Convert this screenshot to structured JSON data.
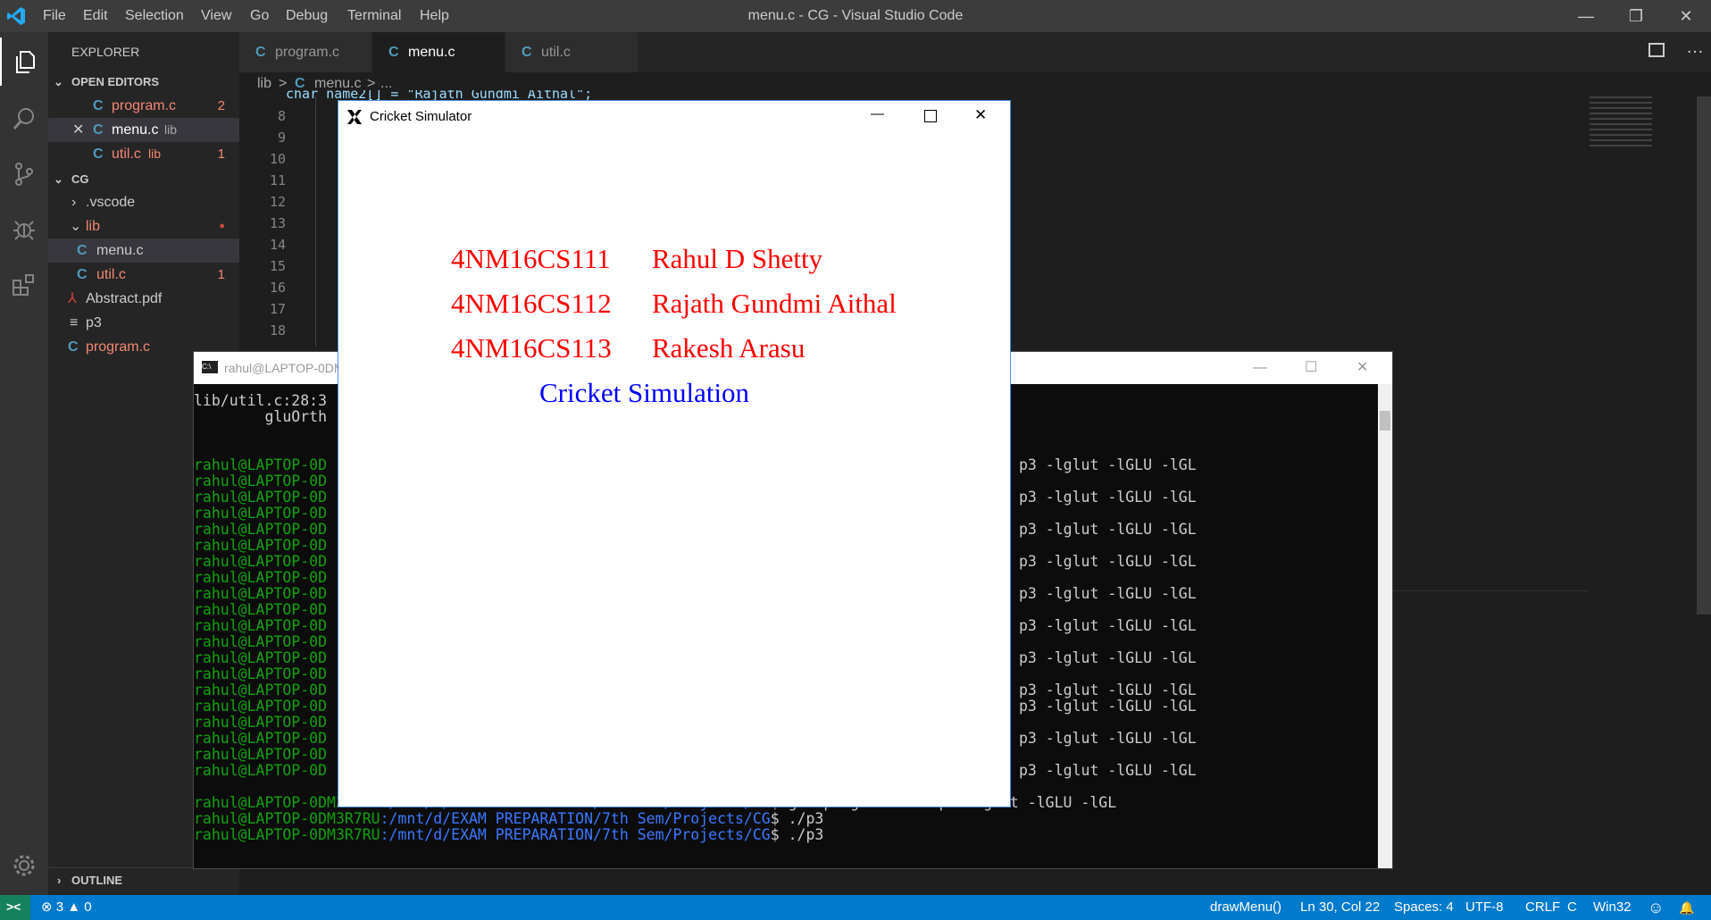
{
  "titlebar": {
    "menus": [
      "File",
      "Edit",
      "Selection",
      "View",
      "Go",
      "Debug",
      "Terminal",
      "Help"
    ],
    "window_title": "menu.c - CG - Visual Studio Code",
    "minimize": "—",
    "restore": "❐",
    "close": "✕"
  },
  "sidebar": {
    "explorer_title": "EXPLORER",
    "open_editors_title": "OPEN EDITORS",
    "open_editors": [
      {
        "icon": "C",
        "name": "program.c",
        "dir": "",
        "badge": "2"
      },
      {
        "icon": "C",
        "name": "menu.c",
        "dir": "lib",
        "badge": ""
      },
      {
        "icon": "C",
        "name": "util.c",
        "dir": "lib",
        "badge": "1"
      }
    ],
    "folder_title": "CG",
    "tree": [
      {
        "icon": "›",
        "name": ".vscode",
        "badge": ""
      },
      {
        "icon": "⌄",
        "name": "lib",
        "badge": "●"
      },
      {
        "icon": "C",
        "name": "menu.c",
        "badge": ""
      },
      {
        "icon": "C",
        "name": "util.c",
        "badge": "1"
      },
      {
        "icon": "⅄",
        "name": "Abstract.pdf",
        "badge": ""
      },
      {
        "icon": "≡",
        "name": "p3",
        "badge": ""
      },
      {
        "icon": "C",
        "name": "program.c",
        "badge": "●"
      }
    ],
    "outline_title": "OUTLINE"
  },
  "tabs": [
    {
      "icon": "C",
      "label": "program.c"
    },
    {
      "icon": "C",
      "label": "menu.c",
      "close": "✕"
    },
    {
      "icon": "C",
      "label": "util.c"
    }
  ],
  "breadcrumb": {
    "folder": "lib",
    "sep": ">",
    "file": "menu.c",
    "rest": "..."
  },
  "code": {
    "line_numbers": [
      "8",
      "9",
      "10",
      "11",
      "12",
      "13",
      "14",
      "15",
      "16",
      "17",
      "18"
    ],
    "partial_line": "char name2[] = \"Rajath Gundmi Aithal\";"
  },
  "statusbar": {
    "remote": "><",
    "errors": "3",
    "warnings": "0",
    "function": "drawMenu()",
    "position": "Ln 30, Col 22",
    "spaces": "Spaces: 4",
    "encoding": "UTF-8",
    "eol": "CRLF",
    "language": "C",
    "platform": "Win32",
    "smiley": "☺",
    "bell": "🔔"
  },
  "terminal": {
    "title": "rahul@LAPTOP-0DM3R7RU: /mnt/d/EXAM PREPARATION/7th Sem/Projects/CG",
    "title_visible": "rahul@LAPTOP-0DM",
    "error_line1": "lib/util.c:28:3",
    "error_line2": "        gluOrth",
    "prompt_user": "rahul@LAPTOP-0DM3R7RU",
    "prompt_user_trunc": "rahul@LAPTOP-0D",
    "prompt_path": ":/mnt/d/EXAM PREPARATION/7th Sem/Projects/CG",
    "compile_cmd": "$ g++ program.c -o p3 -lglut -lGLU -lGL",
    "compile_tail": "p3 -lglut -lGLU -lGL",
    "run_cmd": "$ ./p3"
  },
  "glut_window": {
    "title": "Cricket Simulator",
    "rows": [
      {
        "id": "4NM16CS111",
        "name": "Rahul D Shetty"
      },
      {
        "id": "4NM16CS112",
        "name": "Rajath Gundmi Aithal"
      },
      {
        "id": "4NM16CS113",
        "name": "Rakesh Arasu"
      }
    ],
    "subtitle": "Cricket Simulation"
  },
  "colors": {
    "accent": "#007acc",
    "term_green": "#13a10e",
    "term_blue": "#3b78ff",
    "glut_red": "#ff0000",
    "glut_blue": "#0000ff"
  }
}
